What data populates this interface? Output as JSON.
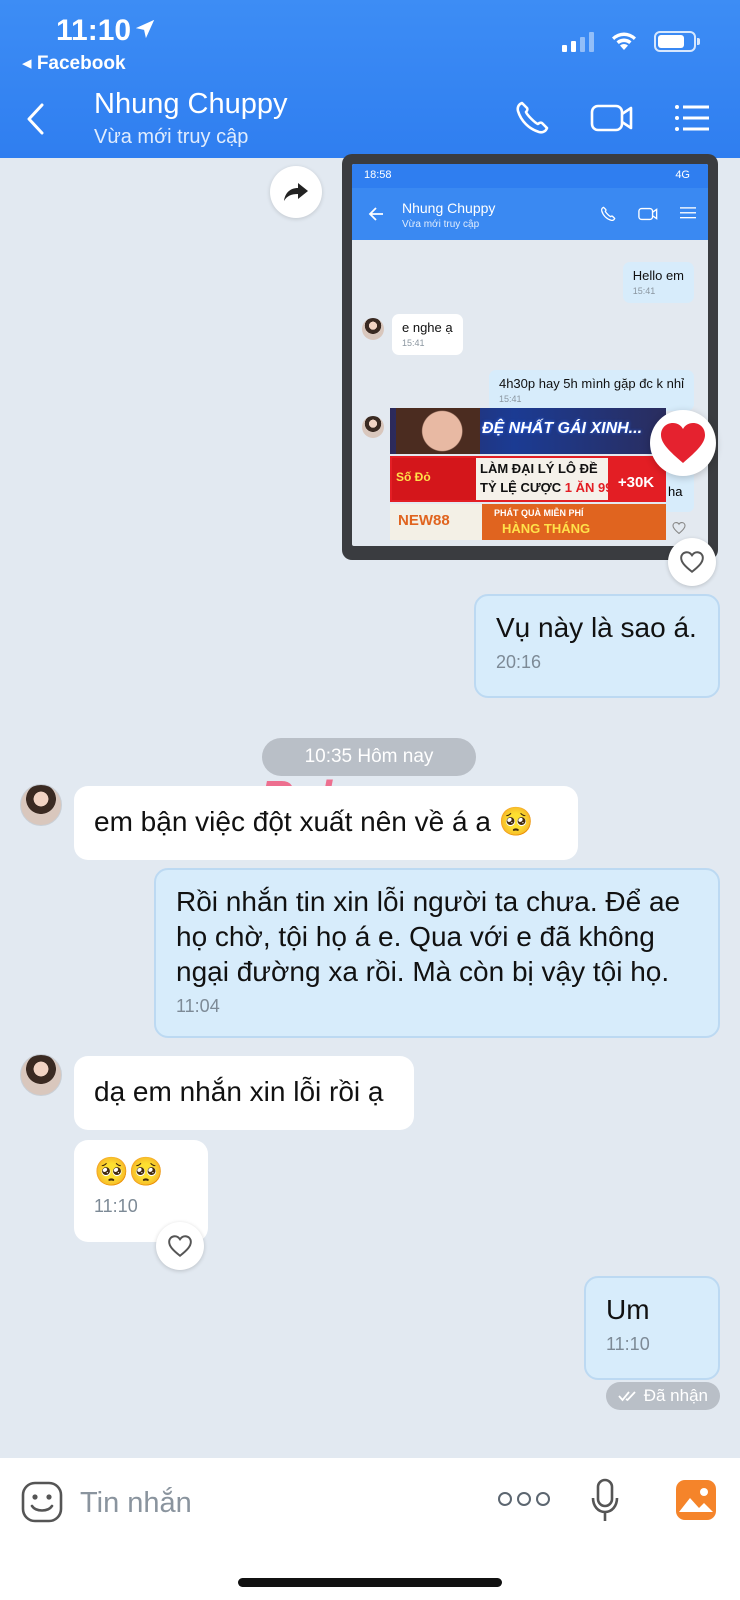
{
  "status_bar": {
    "time": "11:10",
    "back_app": "◂ Facebook"
  },
  "header": {
    "contact_name": "Nhung Chuppy",
    "contact_status": "Vừa mới truy cập"
  },
  "embedded_screenshot": {
    "time": "18:58",
    "right_status": "4G",
    "contact_name": "Nhung Chuppy",
    "contact_status": "Vừa mới truy cập",
    "messages": [
      {
        "text": "Hello em",
        "time": "15:41"
      },
      {
        "text": "e nghe ạ",
        "time": "15:41"
      },
      {
        "text": "4h30p hay 5h mình gặp đc k nhỉ",
        "time": "15:41"
      },
      {
        "text": "ha"
      }
    ],
    "ads": {
      "ad1": "ĐỆ NHẤT GÁI XINH...",
      "ad2_logo": "Số Đỏ",
      "ad2_line1": "LÀM ĐẠI LÝ LÔ ĐỀ",
      "ad2_line2": "TỶ LỆ CƯỢC",
      "ad2_odds": "1 ĂN 99.5",
      "ad2_bonus": "+30K",
      "ad3_logo": "NEW88",
      "ad3_line1": "PHÁT QUÀ MIỄN PHÍ",
      "ad3_line2": "HÀNG THÁNG"
    }
  },
  "messages": [
    {
      "text": "Vụ này là sao á.",
      "time": "20:16"
    },
    {
      "text": "em bận việc đột xuất nên về á a 🥺"
    },
    {
      "text": "Rồi nhắn tin xin lỗi người ta chưa. Để ae họ chờ, tội họ á e. Qua với e đã không ngại đường xa rồi. Mà còn bị vậy tội họ.",
      "time": "11:04"
    },
    {
      "text": "dạ em nhắn xin lỗi rồi ạ"
    },
    {
      "text": "🥺🥺",
      "time": "11:10"
    },
    {
      "text": "Um",
      "time": "11:10"
    }
  ],
  "date_separator": "10:35 Hôm nay",
  "watermark": {
    "part1": "Rphang",
    "part2": "x"
  },
  "received_label": "Đã nhận",
  "input": {
    "placeholder": "Tin nhắn"
  },
  "colors": {
    "header": "#2f7ef0",
    "outgoing_bubble": "#d7ecfb",
    "incoming_bubble": "#ffffff",
    "chat_bg": "#e2e9f1"
  }
}
